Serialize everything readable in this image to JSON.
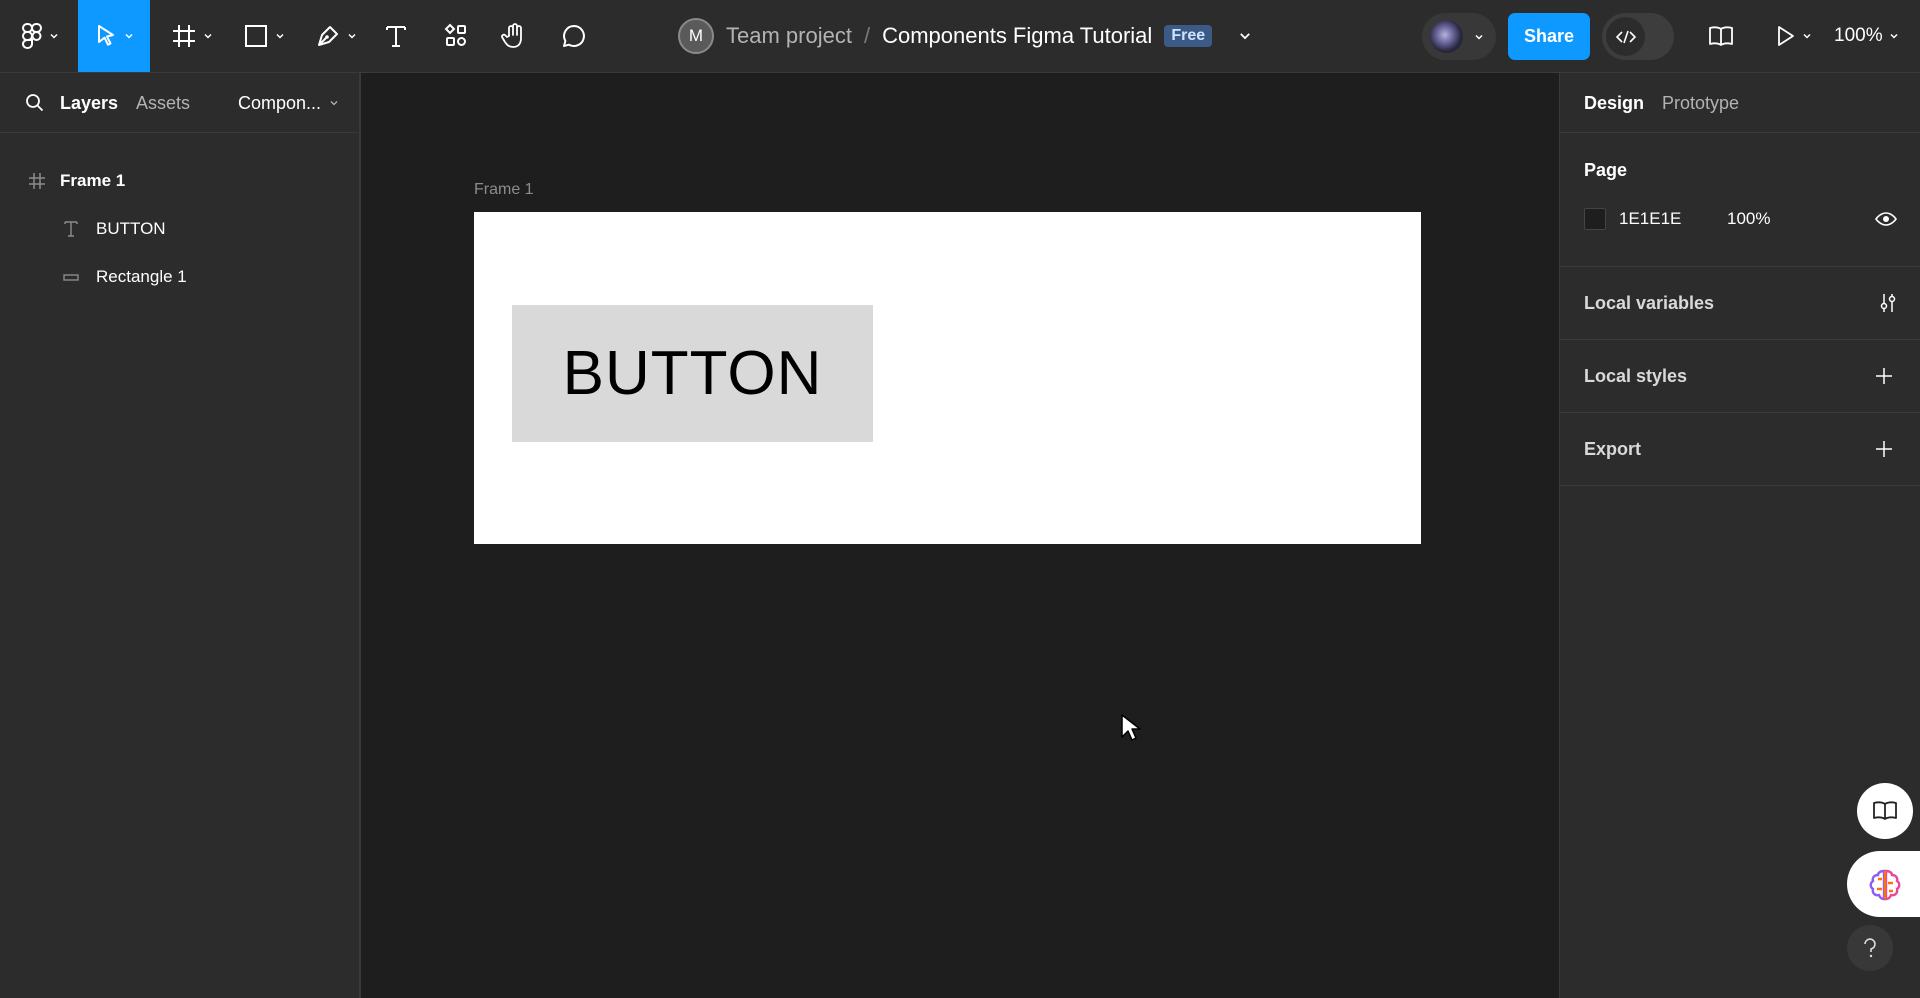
{
  "toolbar": {
    "tools": [
      "main-menu",
      "move",
      "frame",
      "shape",
      "pen",
      "text",
      "resources",
      "hand",
      "comment"
    ],
    "active_tool": "move"
  },
  "breadcrumb": {
    "avatar_initial": "M",
    "team": "Team project",
    "separator": "/",
    "file": "Components Figma Tutorial",
    "plan_badge": "Free"
  },
  "header_right": {
    "share_label": "Share",
    "zoom_label": "100%"
  },
  "left_panel": {
    "tabs": [
      "Layers",
      "Assets"
    ],
    "active_tab": "Layers",
    "page_selector": "Compon...",
    "layers": [
      {
        "name": "Frame 1",
        "type": "frame-icon"
      },
      {
        "name": "BUTTON",
        "type": "text-icon"
      },
      {
        "name": "Rectangle 1",
        "type": "rectangle-icon"
      }
    ]
  },
  "canvas": {
    "frame_label": "Frame 1",
    "button_text": "BUTTON"
  },
  "right_panel": {
    "tabs": [
      "Design",
      "Prototype"
    ],
    "active_tab": "Design",
    "page_section": {
      "title": "Page",
      "color_hex": "1E1E1E",
      "opacity": "100%"
    },
    "local_variables": "Local variables",
    "local_styles": "Local styles",
    "export": "Export"
  },
  "colors": {
    "accent": "#0d99ff",
    "panel": "#2c2c2c",
    "canvas": "#1e1e1e"
  }
}
